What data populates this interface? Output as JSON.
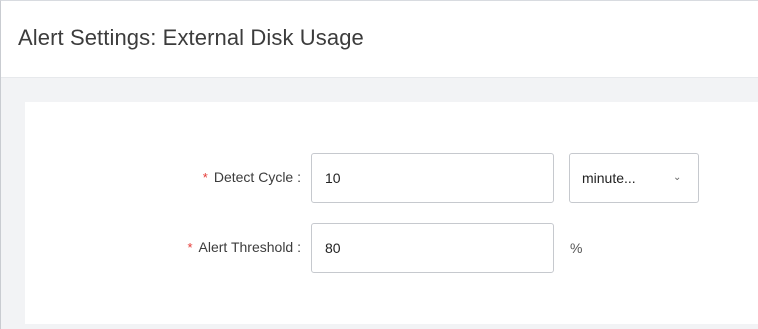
{
  "dialog": {
    "title": "Alert Settings: External Disk Usage"
  },
  "form": {
    "required_mark": "*",
    "detect_cycle": {
      "label": "Detect Cycle :",
      "value": "10",
      "unit_select": "minute...",
      "chevron_icon": "chevron-down-icon"
    },
    "alert_threshold": {
      "label": "Alert Threshold :",
      "value": "80",
      "unit": "%"
    }
  },
  "colors": {
    "required": "#e53935",
    "background": "#f2f3f5",
    "border": "#c6c9ce"
  }
}
